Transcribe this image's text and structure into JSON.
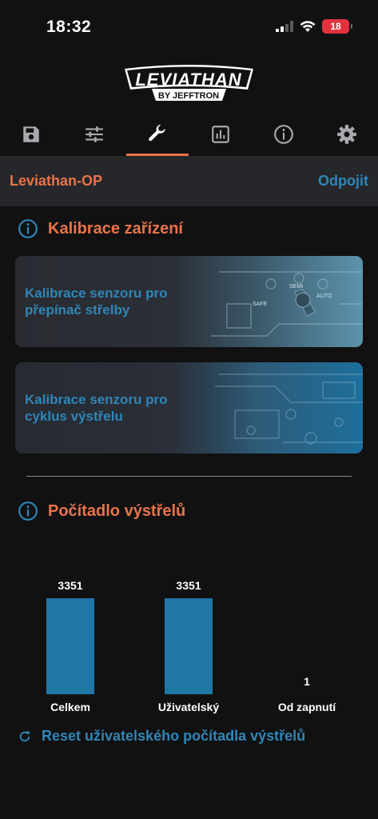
{
  "status_bar": {
    "time": "18:32",
    "battery": "18",
    "battery_color": "#e3323e"
  },
  "logo": {
    "title": "LEVIATHAN",
    "subtitle": "BY JEFFTRON"
  },
  "tabs": [
    {
      "icon": "save-icon",
      "active": false
    },
    {
      "icon": "sliders-icon",
      "active": false
    },
    {
      "icon": "wrench-icon",
      "active": true
    },
    {
      "icon": "bar-chart-icon",
      "active": false
    },
    {
      "icon": "info-icon",
      "active": false
    },
    {
      "icon": "gear-icon",
      "active": false
    }
  ],
  "device_bar": {
    "name": "Leviathan-OP",
    "disconnect_label": "Odpojit"
  },
  "calibration": {
    "title": "Kalibrace zařízení",
    "cards": [
      {
        "line1": "Kalibrace senzoru pro",
        "line2": "přepínač střelby",
        "art": [
          "SAFE",
          "SEMI",
          "AUTO"
        ]
      },
      {
        "line1": "Kalibrace senzoru pro",
        "line2": "cyklus výstřelu"
      }
    ]
  },
  "counter": {
    "title": "Počítadlo výstřelů",
    "reset_label": "Reset uživatelského počítadla výstřelů"
  },
  "chart_data": {
    "type": "bar",
    "categories": [
      "Celkem",
      "Uživatelský",
      "Od zapnutí"
    ],
    "values": [
      3351,
      3351,
      1
    ],
    "value_labels": [
      "3351",
      "3351",
      "1"
    ],
    "title": "",
    "xlabel": "",
    "ylabel": "",
    "ylim": [
      0,
      3351
    ],
    "color": "#1f77a6"
  },
  "colors": {
    "accent_orange": "#e8744a",
    "accent_blue": "#2f86b8",
    "background": "#111112"
  }
}
